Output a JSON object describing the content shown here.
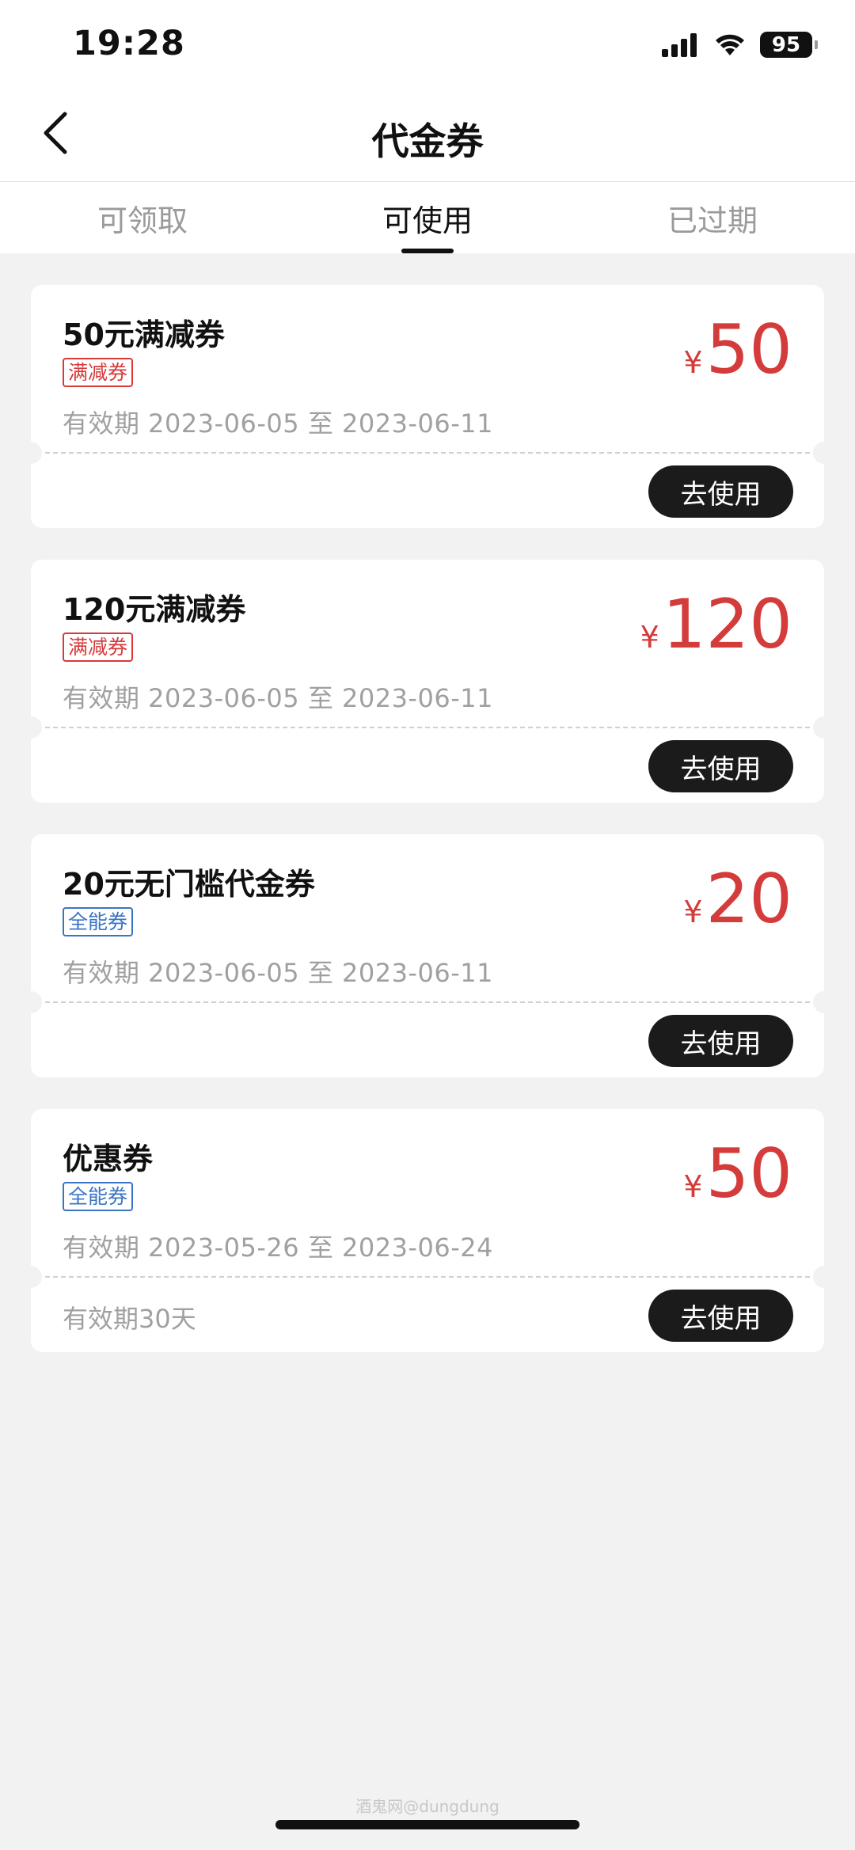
{
  "status": {
    "time": "19:28",
    "battery": "95"
  },
  "nav": {
    "title": "代金券"
  },
  "tabs": [
    {
      "label": "可领取"
    },
    {
      "label": "可使用",
      "active": true
    },
    {
      "label": "已过期"
    }
  ],
  "coupons": [
    {
      "name": "50元满减券",
      "tag": "满减券",
      "tag_color": "red",
      "validity": "有效期 2023-06-05 至 2023-06-11",
      "currency": "¥",
      "amount": "50",
      "note": "",
      "button": "去使用"
    },
    {
      "name": "120元满减券",
      "tag": "满减券",
      "tag_color": "red",
      "validity": "有效期 2023-06-05 至 2023-06-11",
      "currency": "¥",
      "amount": "120",
      "note": "",
      "button": "去使用"
    },
    {
      "name": "20元无门槛代金券",
      "tag": "全能券",
      "tag_color": "blue",
      "validity": "有效期 2023-06-05 至 2023-06-11",
      "currency": "¥",
      "amount": "20",
      "note": "",
      "button": "去使用"
    },
    {
      "name": "优惠券",
      "tag": "全能券",
      "tag_color": "blue",
      "validity": "有效期 2023-05-26 至 2023-06-24",
      "currency": "¥",
      "amount": "50",
      "note": "有效期30天",
      "button": "去使用"
    }
  ],
  "watermark": "酒鬼网@dungdung",
  "colors": {
    "accent": "#d43b3b",
    "tag_blue": "#3b74c4",
    "button_bg": "#1b1b1b",
    "background": "#f2f2f2"
  }
}
